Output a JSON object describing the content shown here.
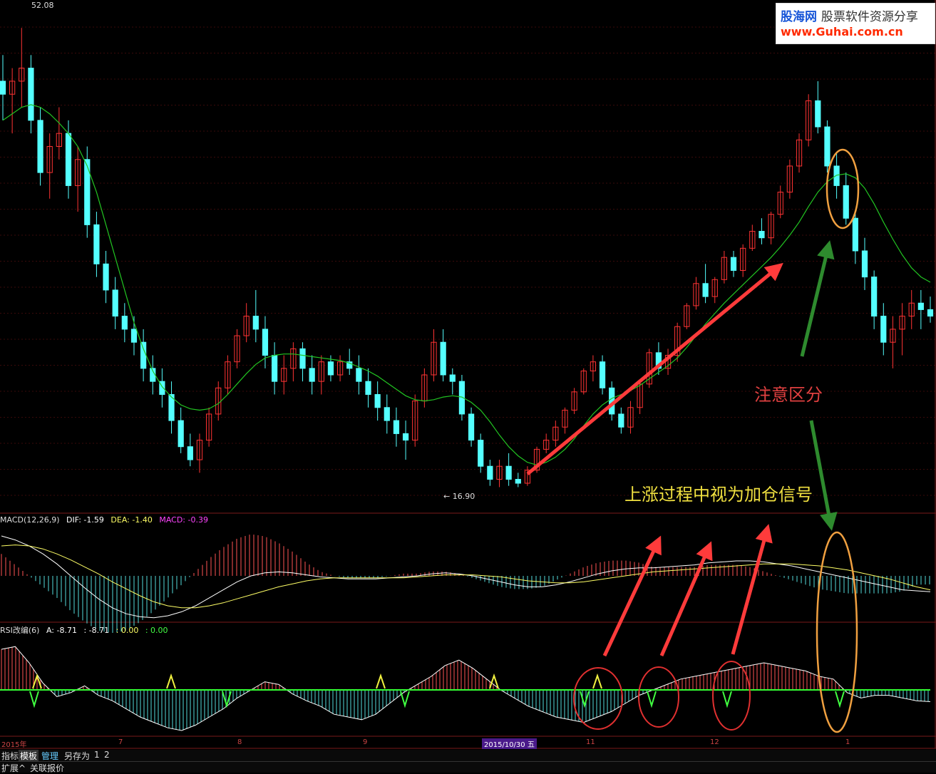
{
  "logo": {
    "brand": "股海网",
    "tagline": "股票软件资源分享",
    "url": "www.Guhai.com.cn"
  },
  "price_labels": {
    "high": "52.08",
    "low": "16.90"
  },
  "macd_header": {
    "name": "MACD(12,26,9)",
    "dif": "DIF: -1.59",
    "dea": "DEA: -1.40",
    "macd": "MACD: -0.39"
  },
  "rsi_header": {
    "name": "RSI改编(6)",
    "a": "A: -8.71",
    "b": ": -8.71",
    "c": ": 0.00",
    "d": ": 0.00"
  },
  "annotations": {
    "note1": "注意区分",
    "note2": "上涨过程中视为加仓信号"
  },
  "x_axis": [
    "2015年",
    "7",
    "8",
    "9",
    "2015/10/30 五",
    "11",
    "12",
    "1"
  ],
  "toolbar": {
    "items": [
      "指标",
      "模板",
      "管理",
      "另存为",
      "1",
      "2"
    ]
  },
  "toolbar2": {
    "items": [
      "扩展^",
      "关联报价"
    ]
  },
  "colors": {
    "up": "#ff3333",
    "down": "#54ffff",
    "ma": "#22c522",
    "macd_dif": "#ffffff",
    "macd_dea": "#ffff66",
    "arrow_red": "#ff3b3b",
    "arrow_green": "#2e8b2e",
    "circle_orange": "#f0a040",
    "zero_line": "#33ff33"
  },
  "chart_data": [
    {
      "type": "candlestick",
      "title": "",
      "ylabel": "",
      "ylim": [
        16.0,
        54.0
      ],
      "annotations": [
        "52.08",
        "16.90"
      ],
      "ohlc": [
        [
          48,
          50,
          45,
          47
        ],
        [
          47,
          49,
          44,
          48
        ],
        [
          48,
          52.08,
          46,
          49
        ],
        [
          49,
          50,
          44,
          45
        ],
        [
          45,
          46,
          40,
          41
        ],
        [
          41,
          44,
          39,
          43
        ],
        [
          43,
          46,
          42,
          44
        ],
        [
          44,
          45,
          39,
          40
        ],
        [
          40,
          43,
          38,
          42
        ],
        [
          42,
          43,
          36,
          37
        ],
        [
          37,
          38,
          33,
          34
        ],
        [
          34,
          35,
          31,
          32
        ],
        [
          32,
          33,
          29,
          30
        ],
        [
          30,
          31,
          28,
          29
        ],
        [
          29,
          30,
          27,
          28
        ],
        [
          28,
          29,
          25,
          26
        ],
        [
          26,
          27,
          24,
          25
        ],
        [
          25,
          26,
          23,
          24
        ],
        [
          24,
          25,
          21,
          22
        ],
        [
          22,
          23,
          19.5,
          20
        ],
        [
          20,
          21,
          18.5,
          19
        ],
        [
          19,
          21,
          18,
          20.5
        ],
        [
          20.5,
          23,
          20,
          22.5
        ],
        [
          22.5,
          25,
          22,
          24.5
        ],
        [
          24.5,
          27,
          24,
          26.5
        ],
        [
          26.5,
          29,
          26,
          28.5
        ],
        [
          28.5,
          31,
          28,
          30
        ],
        [
          30,
          32,
          28,
          29
        ],
        [
          29,
          30,
          26,
          27
        ],
        [
          27,
          28,
          24,
          25
        ],
        [
          25,
          27,
          24,
          26
        ],
        [
          26,
          28,
          25,
          27.5
        ],
        [
          27.5,
          28,
          25,
          26
        ],
        [
          26,
          27,
          24,
          25
        ],
        [
          25,
          27,
          24,
          26.5
        ],
        [
          26.5,
          27,
          25,
          25.5
        ],
        [
          25.5,
          27,
          25,
          26.5
        ],
        [
          26.5,
          27.5,
          25.5,
          26
        ],
        [
          26,
          27,
          24,
          25
        ],
        [
          25,
          26,
          23,
          24
        ],
        [
          24,
          25,
          22,
          23
        ],
        [
          23,
          24,
          21,
          22
        ],
        [
          22,
          23,
          20,
          21
        ],
        [
          21,
          22,
          19,
          20.5
        ],
        [
          20.5,
          24,
          20,
          23.5
        ],
        [
          23.5,
          26,
          23,
          25.5
        ],
        [
          25.5,
          29,
          25,
          28
        ],
        [
          28,
          29,
          25,
          25.5
        ],
        [
          25.5,
          26,
          24,
          25
        ],
        [
          25,
          25.5,
          22,
          22.5
        ],
        [
          22.5,
          23,
          20,
          20.5
        ],
        [
          20.5,
          21,
          18,
          18.5
        ],
        [
          18.5,
          19,
          17,
          17.5
        ],
        [
          17.5,
          19,
          16.9,
          18.5
        ],
        [
          18.5,
          19.5,
          17,
          17.5
        ],
        [
          17.5,
          18,
          16.9,
          17.2
        ],
        [
          17.2,
          18.5,
          17,
          18.2
        ],
        [
          18.2,
          20,
          18,
          19.8
        ],
        [
          19.8,
          21,
          19.5,
          20.5
        ],
        [
          20.5,
          22,
          20,
          21.5
        ],
        [
          21.5,
          23,
          21,
          22.8
        ],
        [
          22.8,
          24.5,
          22.5,
          24.2
        ],
        [
          24.2,
          26,
          24,
          25.8
        ],
        [
          25.8,
          27,
          25,
          26.5
        ],
        [
          26.5,
          27,
          24,
          24.5
        ],
        [
          24.5,
          25,
          22,
          22.5
        ],
        [
          22.5,
          23,
          21,
          21.5
        ],
        [
          21.5,
          23.5,
          21,
          23
        ],
        [
          23,
          25,
          22.5,
          24.8
        ],
        [
          24.8,
          27.5,
          24.5,
          27.2
        ],
        [
          27.2,
          28,
          25.5,
          26
        ],
        [
          26,
          27.5,
          25.5,
          27
        ],
        [
          27,
          29.5,
          26.5,
          29.2
        ],
        [
          29.2,
          31,
          29,
          30.8
        ],
        [
          30.8,
          33,
          30.5,
          32.5
        ],
        [
          32.5,
          34,
          31,
          31.5
        ],
        [
          31.5,
          33,
          31,
          32.8
        ],
        [
          32.8,
          35,
          32.5,
          34.5
        ],
        [
          34.5,
          35,
          33,
          33.5
        ],
        [
          33.5,
          35.5,
          33,
          35.2
        ],
        [
          35.2,
          37,
          35,
          36.5
        ],
        [
          36.5,
          37.5,
          35.5,
          36
        ],
        [
          36,
          38,
          35.5,
          37.8
        ],
        [
          37.8,
          40,
          37.5,
          39.5
        ],
        [
          39.5,
          42,
          39,
          41.5
        ],
        [
          41.5,
          44,
          41,
          43.5
        ],
        [
          43.5,
          47,
          43,
          46.5
        ],
        [
          46.5,
          48,
          44,
          44.5
        ],
        [
          44.5,
          45,
          41,
          41.5
        ],
        [
          41.5,
          42.5,
          39,
          40
        ],
        [
          40,
          41,
          37,
          37.5
        ],
        [
          37.5,
          38,
          34,
          35
        ],
        [
          35,
          36,
          32,
          33
        ],
        [
          33,
          33.5,
          29,
          30
        ],
        [
          30,
          31,
          27,
          28
        ],
        [
          28,
          30,
          26,
          29
        ],
        [
          29,
          31,
          27,
          30
        ],
        [
          30,
          32,
          29,
          31
        ],
        [
          31,
          32,
          29,
          30.5
        ],
        [
          30.5,
          31.5,
          29.5,
          30
        ]
      ],
      "ma": {
        "name": "",
        "values": [
          45,
          45.5,
          46,
          46.2,
          46,
          45.5,
          44.8,
          44,
          43,
          41.5,
          39.5,
          37,
          34.5,
          32,
          29.5,
          27.5,
          25.8,
          24.6,
          23.8,
          23.2,
          22.9,
          22.8,
          22.9,
          23.3,
          24,
          24.8,
          25.6,
          26.3,
          26.8,
          27,
          27.1,
          27.1,
          27,
          26.9,
          26.8,
          26.7,
          26.6,
          26.4,
          26.1,
          25.8,
          25.4,
          24.9,
          24.4,
          23.9,
          23.6,
          23.5,
          23.6,
          23.8,
          23.9,
          23.8,
          23.4,
          22.8,
          21.9,
          20.9,
          20,
          19.3,
          18.8,
          18.6,
          18.8,
          19.2,
          19.8,
          20.6,
          21.6,
          22.5,
          23.2,
          23.7,
          24,
          24.3,
          24.7,
          25.2,
          25.7,
          26.2,
          26.8,
          27.6,
          28.5,
          29.4,
          30.2,
          31,
          31.7,
          32.4,
          33.1,
          33.8,
          34.5,
          35.3,
          36.2,
          37.2,
          38.4,
          39.5,
          40.3,
          40.8,
          40.9,
          40.6,
          39.8,
          38.6,
          37.2,
          35.9,
          34.7,
          33.7,
          33,
          32.6
        ]
      }
    },
    {
      "type": "bar",
      "title": "MACD(12,26,9)",
      "series": [
        {
          "name": "DIF",
          "values": [
            4,
            3.6,
            3,
            2.2,
            1.2,
            0,
            -1.2,
            -2.3,
            -3.2,
            -3.8,
            -4.1,
            -4.2,
            -4,
            -3.6,
            -3,
            -2.2,
            -1.4,
            -0.6,
            0,
            0.3,
            0.4,
            0.3,
            0.1,
            -0.1,
            -0.2,
            -0.3,
            -0.3,
            -0.3,
            -0.2,
            -0.1,
            0,
            0.2,
            0.3,
            0.2,
            0,
            -0.3,
            -0.6,
            -0.9,
            -1.1,
            -1.1,
            -0.9,
            -0.6,
            -0.2,
            0.2,
            0.5,
            0.7,
            0.8,
            0.8,
            0.9,
            1,
            1.1,
            1.3,
            1.4,
            1.5,
            1.5,
            1.4,
            1.2,
            1,
            0.7,
            0.4,
            0.1,
            -0.2,
            -0.5,
            -0.8,
            -1.1,
            -1.4,
            -1.5,
            -1.59
          ]
        },
        {
          "name": "DEA",
          "values": [
            3,
            3.1,
            3,
            2.7,
            2.2,
            1.6,
            0.9,
            0.2,
            -0.6,
            -1.3,
            -2,
            -2.6,
            -3,
            -3.2,
            -3.2,
            -3,
            -2.7,
            -2.3,
            -1.9,
            -1.5,
            -1.1,
            -0.8,
            -0.5,
            -0.3,
            -0.2,
            -0.2,
            -0.2,
            -0.2,
            -0.2,
            -0.2,
            -0.1,
            0,
            0.1,
            0.1,
            0.1,
            0,
            -0.1,
            -0.3,
            -0.5,
            -0.6,
            -0.7,
            -0.7,
            -0.6,
            -0.4,
            -0.2,
            0,
            0.2,
            0.4,
            0.5,
            0.6,
            0.7,
            0.8,
            0.9,
            1,
            1.1,
            1.2,
            1.2,
            1.2,
            1.1,
            1,
            0.8,
            0.6,
            0.3,
            0,
            -0.3,
            -0.7,
            -1.1,
            -1.4
          ]
        },
        {
          "name": "MACD",
          "values": [
            1,
            0.5,
            0,
            -0.5,
            -1,
            -1.6,
            -2.1,
            -2.5,
            -2.6,
            -2.5,
            -2.1,
            -1.6,
            -1,
            -0.4,
            0.2,
            0.8,
            1.3,
            1.7,
            1.9,
            1.8,
            1.5,
            1.1,
            0.6,
            0.2,
            0,
            -0.1,
            -0.1,
            -0.1,
            0,
            0.1,
            0.1,
            0.2,
            0.2,
            0.1,
            -0.1,
            -0.3,
            -0.5,
            -0.6,
            -0.6,
            -0.5,
            -0.2,
            0.1,
            0.4,
            0.6,
            0.7,
            0.7,
            0.6,
            0.4,
            0.4,
            0.4,
            0.4,
            0.5,
            0.5,
            0.5,
            0.4,
            0.2,
            0,
            -0.2,
            -0.4,
            -0.6,
            -0.7,
            -0.8,
            -0.8,
            -0.8,
            -0.8,
            -0.7,
            -0.4,
            -0.39
          ]
        }
      ]
    },
    {
      "type": "bar",
      "title": "RSI改编(6)",
      "series": [
        {
          "name": "A",
          "values": [
            30,
            32,
            20,
            5,
            -5,
            -2,
            3,
            -4,
            -8,
            -14,
            -20,
            -24,
            -28,
            -30,
            -26,
            -20,
            -14,
            -6,
            0,
            6,
            4,
            -3,
            -8,
            -12,
            -18,
            -20,
            -22,
            -18,
            -10,
            -2,
            4,
            10,
            18,
            22,
            16,
            8,
            0,
            -6,
            -12,
            -16,
            -20,
            -22,
            -24,
            -20,
            -16,
            -10,
            -4,
            0,
            4,
            8,
            10,
            12,
            14,
            16,
            18,
            20,
            18,
            16,
            14,
            10,
            8,
            -2,
            -6,
            -4,
            -4,
            -6,
            -8,
            -8.71
          ]
        }
      ]
    }
  ]
}
